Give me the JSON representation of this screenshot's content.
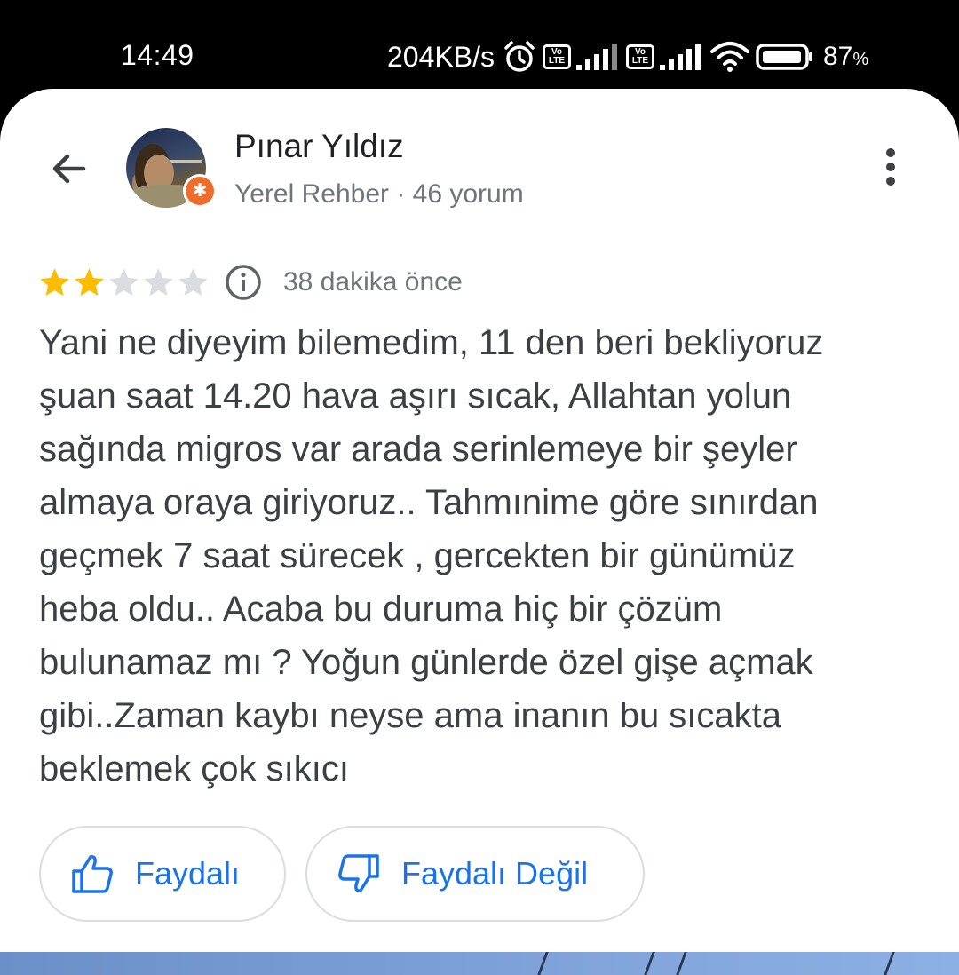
{
  "status_bar": {
    "time": "14:49",
    "network_speed": "204KB/s",
    "volte_top": "Vo",
    "volte_bottom": "LTE",
    "battery_percent": "87",
    "battery_symbol": "%"
  },
  "review": {
    "user_name": "Pınar Yıldız",
    "user_meta": "Yerel Rehber · 46 yorum",
    "rating": 2,
    "max_rating": 5,
    "time_ago": "38 dakika önce",
    "text": "Yani ne diyeyim bilemedim, 11 den beri bekliyoruz\nşuan saat 14.20 hava aşırı sıcak, Allahtan yolun\nsağında migros var arada serinlemeye bir şeyler\nalmaya oraya giriyoruz.. Tahmınime göre sınırdan\ngeçmek 7 saat sürecek , gercekten bir günümüz\nheba oldu.. Acaba bu duruma hiç bir çözüm\nbulunamaz mı ? Yoğun günlerde özel gişe açmak\ngibi..Zaman kaybı neyse ama inanın bu sıcakta\nbeklemek çok sıkıcı"
  },
  "actions": {
    "helpful_label": "Faydalı",
    "not_helpful_label": "Faydalı Değil"
  },
  "colors": {
    "accent": "#1a73e8",
    "star_filled": "#fbbc04",
    "star_empty": "#dadce0",
    "badge": "#ee6d2d"
  }
}
